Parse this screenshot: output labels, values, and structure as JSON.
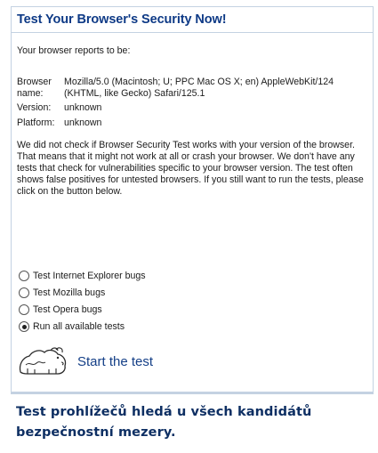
{
  "title": "Test Your Browser's Security Now!",
  "intro": "Your browser reports to be:",
  "browser_info": {
    "browser_label": "Browser name:",
    "browser_value": "Mozilla/5.0 (Macintosh; U; PPC Mac OS X; en) AppleWebKit/124 (KHTML, like Gecko) Safari/125.1",
    "version_label": "Version:",
    "version_value": "unknown",
    "platform_label": "Platform:",
    "platform_value": "unknown"
  },
  "notice": "We did not check if Browser Security Test works with your version of the browser. That means that it might not work at all or crash your browser. We don't have any tests that check for vulnerabilities specific to your browser version. The test often shows false positives for untested browsers. If you still want to run the tests, please click on the button below.",
  "options": [
    {
      "label": "Test Internet Explorer bugs",
      "selected": false
    },
    {
      "label": "Test Mozilla bugs",
      "selected": false
    },
    {
      "label": "Test Opera bugs",
      "selected": false
    },
    {
      "label": "Run all available tests",
      "selected": true
    }
  ],
  "start_button": {
    "label": "Start the test",
    "icon": "bear-logo-icon"
  },
  "caption": "Test prohlížečů hledá u všech kandidátů bezpečnostní mezery.",
  "colors": {
    "title": "#0e3a86",
    "link": "#143f87",
    "border": "#c4d2e2",
    "caption": "#0e2f63"
  }
}
